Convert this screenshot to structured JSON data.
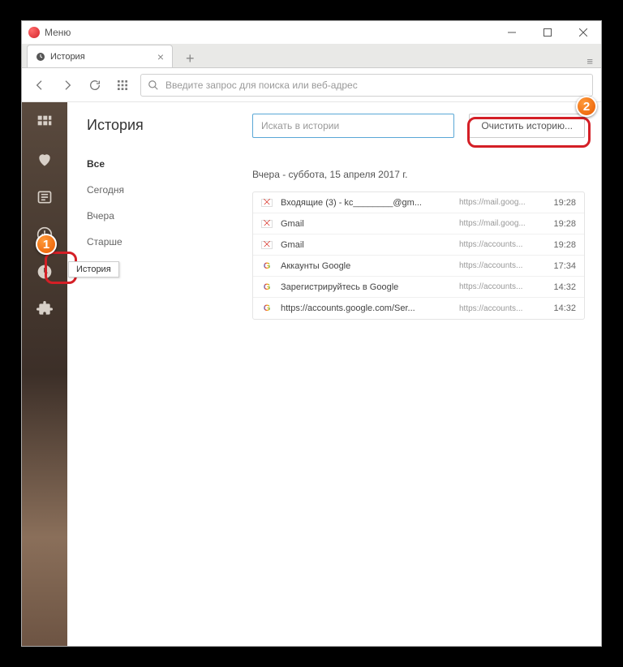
{
  "titlebar": {
    "menu": "Меню"
  },
  "tab": {
    "title": "История"
  },
  "addressbar": {
    "placeholder": "Введите запрос для поиска или веб-адрес"
  },
  "sidebar": {
    "tooltip": "История"
  },
  "page": {
    "title": "История"
  },
  "filters": {
    "all": "Все",
    "today": "Сегодня",
    "yesterday": "Вчера",
    "older": "Старше"
  },
  "search": {
    "placeholder": "Искать в истории"
  },
  "clear": {
    "label": "Очистить историю..."
  },
  "section": {
    "heading": "Вчера - суббота, 15 апреля 2017 г."
  },
  "rows": [
    {
      "icon": "gmail",
      "title": "Входящие (3) - kc________@gm...",
      "url": "https://mail.goog...",
      "time": "19:28"
    },
    {
      "icon": "gmail",
      "title": "Gmail",
      "url": "https://mail.goog...",
      "time": "19:28"
    },
    {
      "icon": "gmail",
      "title": "Gmail",
      "url": "https://accounts...",
      "time": "19:28"
    },
    {
      "icon": "google",
      "title": "Аккаунты Google",
      "url": "https://accounts...",
      "time": "17:34"
    },
    {
      "icon": "google",
      "title": "Зарегистрируйтесь в Google",
      "url": "https://accounts...",
      "time": "14:32"
    },
    {
      "icon": "google",
      "title": "https://accounts.google.com/Ser...",
      "url": "https://accounts...",
      "time": "14:32"
    }
  ],
  "badges": {
    "one": "1",
    "two": "2"
  }
}
